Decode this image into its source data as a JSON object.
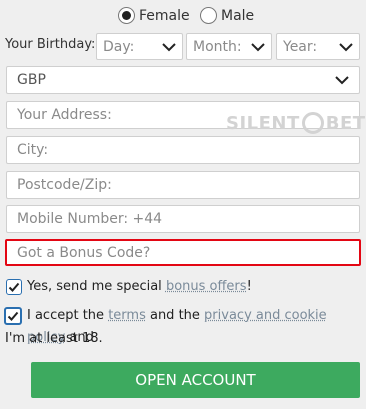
{
  "gender": {
    "options": [
      {
        "label": "Female",
        "selected": true
      },
      {
        "label": "Male",
        "selected": false
      }
    ]
  },
  "birthday": {
    "label": "Your Birthday:",
    "day": "Day:",
    "month": "Month:",
    "year": "Year:"
  },
  "currency": {
    "value": "GBP"
  },
  "fields": {
    "address": "Your Address:",
    "city": "City:",
    "postcode": "Postcode/Zip:",
    "mobile": "Mobile Number: +44",
    "bonus": "Got a Bonus Code?"
  },
  "watermark": {
    "left": "SILENT",
    "right": "BET"
  },
  "consent": {
    "offers_prefix": "Yes, send me special ",
    "offers_link": "bonus offers",
    "offers_suffix": "!",
    "accept_1": "I accept the ",
    "accept_terms": "terms",
    "accept_2": " and the ",
    "accept_privacy": "privacy and cookie policy",
    "accept_3": " and",
    "accept_4": "I'm at least 18."
  },
  "cta": {
    "label": "OPEN ACCOUNT"
  },
  "colors": {
    "accent_green": "#3daa5f",
    "highlight_red": "#e30613",
    "checkbox_blue": "#2a6fb0"
  }
}
